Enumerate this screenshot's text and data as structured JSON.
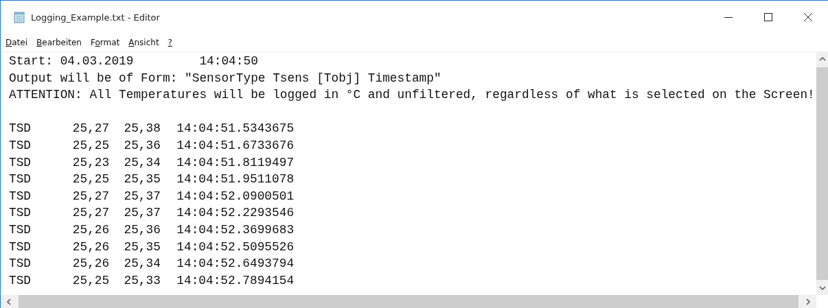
{
  "window": {
    "title": "Logging_Example.txt - Editor"
  },
  "menu": [
    {
      "access_key": "D",
      "suffix": "atei"
    },
    {
      "access_key": "B",
      "suffix": "earbeiten"
    },
    {
      "prefix": "F",
      "access_key": "o",
      "suffix": "rmat"
    },
    {
      "access_key": "A",
      "suffix": "nsicht"
    },
    {
      "access_key": "?"
    }
  ],
  "document": {
    "header_lines": [
      "Start: 04.03.2019         14:04:50",
      "Output will be of Form: \"SensorType Tsens [Tobj] Timestamp\"",
      "ATTENTION: All Temperatures will be logged in °C and unfiltered, regardless of what is selected on the Screen!"
    ],
    "rows": [
      [
        "TSD",
        "25,27",
        "25,38",
        "14:04:51.5343675"
      ],
      [
        "TSD",
        "25,25",
        "25,36",
        "14:04:51.6733676"
      ],
      [
        "TSD",
        "25,23",
        "25,34",
        "14:04:51.8119497"
      ],
      [
        "TSD",
        "25,25",
        "25,35",
        "14:04:51.9511078"
      ],
      [
        "TSD",
        "25,27",
        "25,37",
        "14:04:52.0900501"
      ],
      [
        "TSD",
        "25,27",
        "25,37",
        "14:04:52.2293546"
      ],
      [
        "TSD",
        "25,26",
        "25,36",
        "14:04:52.3699683"
      ],
      [
        "TSD",
        "25,26",
        "25,35",
        "14:04:52.5095526"
      ],
      [
        "TSD",
        "25,26",
        "25,34",
        "14:04:52.6493794"
      ],
      [
        "TSD",
        "25,25",
        "25,33",
        "14:04:52.7894154"
      ]
    ]
  }
}
